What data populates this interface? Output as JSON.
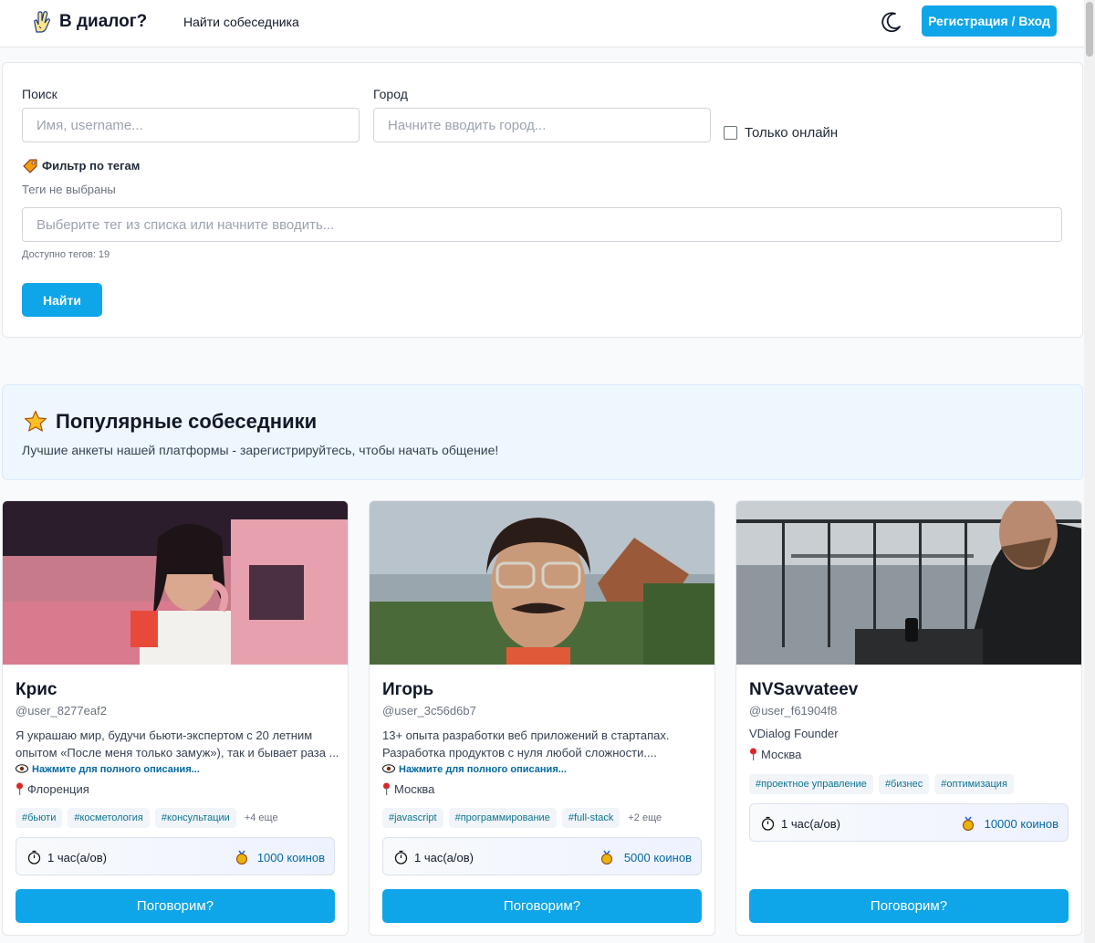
{
  "header": {
    "logo_text": "В диалог?",
    "nav_find": "Найти собеседника",
    "auth_button": "Регистрация / Вход"
  },
  "filters": {
    "search_label": "Поиск",
    "search_placeholder": "Имя, username...",
    "city_label": "Город",
    "city_placeholder": "Начните вводить город...",
    "online_only_label": "Только онлайн",
    "tag_filter_label": "Фильтр по тегам",
    "tags_none": "Теги не выбраны",
    "tag_placeholder": "Выберите тег из списка или начните вводить...",
    "tags_available": "Доступно тегов: 19",
    "find_button": "Найти"
  },
  "popular": {
    "title": "Популярные собеседники",
    "subtitle": "Лучшие анкеты нашей платформы - зарегистрируйтесь, чтобы начать общение!"
  },
  "cards": [
    {
      "name": "Крис",
      "username": "@user_8277eaf2",
      "desc_line1": "Я украшаю мир, будучи бьюти-экспертом с 20 летним",
      "desc_line2": "опытом «После меня только замуж»), так и бывает раза ...",
      "more": "Нажмите для полного описания...",
      "city": "Флоренция",
      "tags": [
        "#бьюти",
        "#косметология",
        "#консультации"
      ],
      "tags_more": "+4 еще",
      "duration": "1 час(а/ов)",
      "price": "1000 коинов",
      "button": "Поговорим?"
    },
    {
      "name": "Игорь",
      "username": "@user_3c56d6b7",
      "desc_line1": "13+ опыта разработки веб приложений в стартапах.",
      "desc_line2": "Разработка продуктов с нуля любой сложности....",
      "more": "Нажмите для полного описания...",
      "city": "Москва",
      "tags": [
        "#javascript",
        "#программирование",
        "#full-stack"
      ],
      "tags_more": "+2 еще",
      "duration": "1 час(а/ов)",
      "price": "5000 коинов",
      "button": "Поговорим?"
    },
    {
      "name": "NVSavvateev",
      "username": "@user_f61904f8",
      "desc_line1": "VDialog Founder",
      "city": "Москва",
      "tags": [
        "#проектное управление",
        "#бизнес",
        "#оптимизация"
      ],
      "duration": "1 час(а/ов)",
      "price": "10000 коинов",
      "button": "Поговорим?"
    }
  ],
  "colors": {
    "accent": "#0ea5e9",
    "link": "#0369a1",
    "tag_text": "#0e7490",
    "banner_bg": "#eef7fe"
  },
  "icons": [
    "hand-logo-icon",
    "moon-icon",
    "tag-icon",
    "star-icon",
    "eye-icon",
    "pin-icon",
    "timer-icon",
    "coin-icon"
  ]
}
